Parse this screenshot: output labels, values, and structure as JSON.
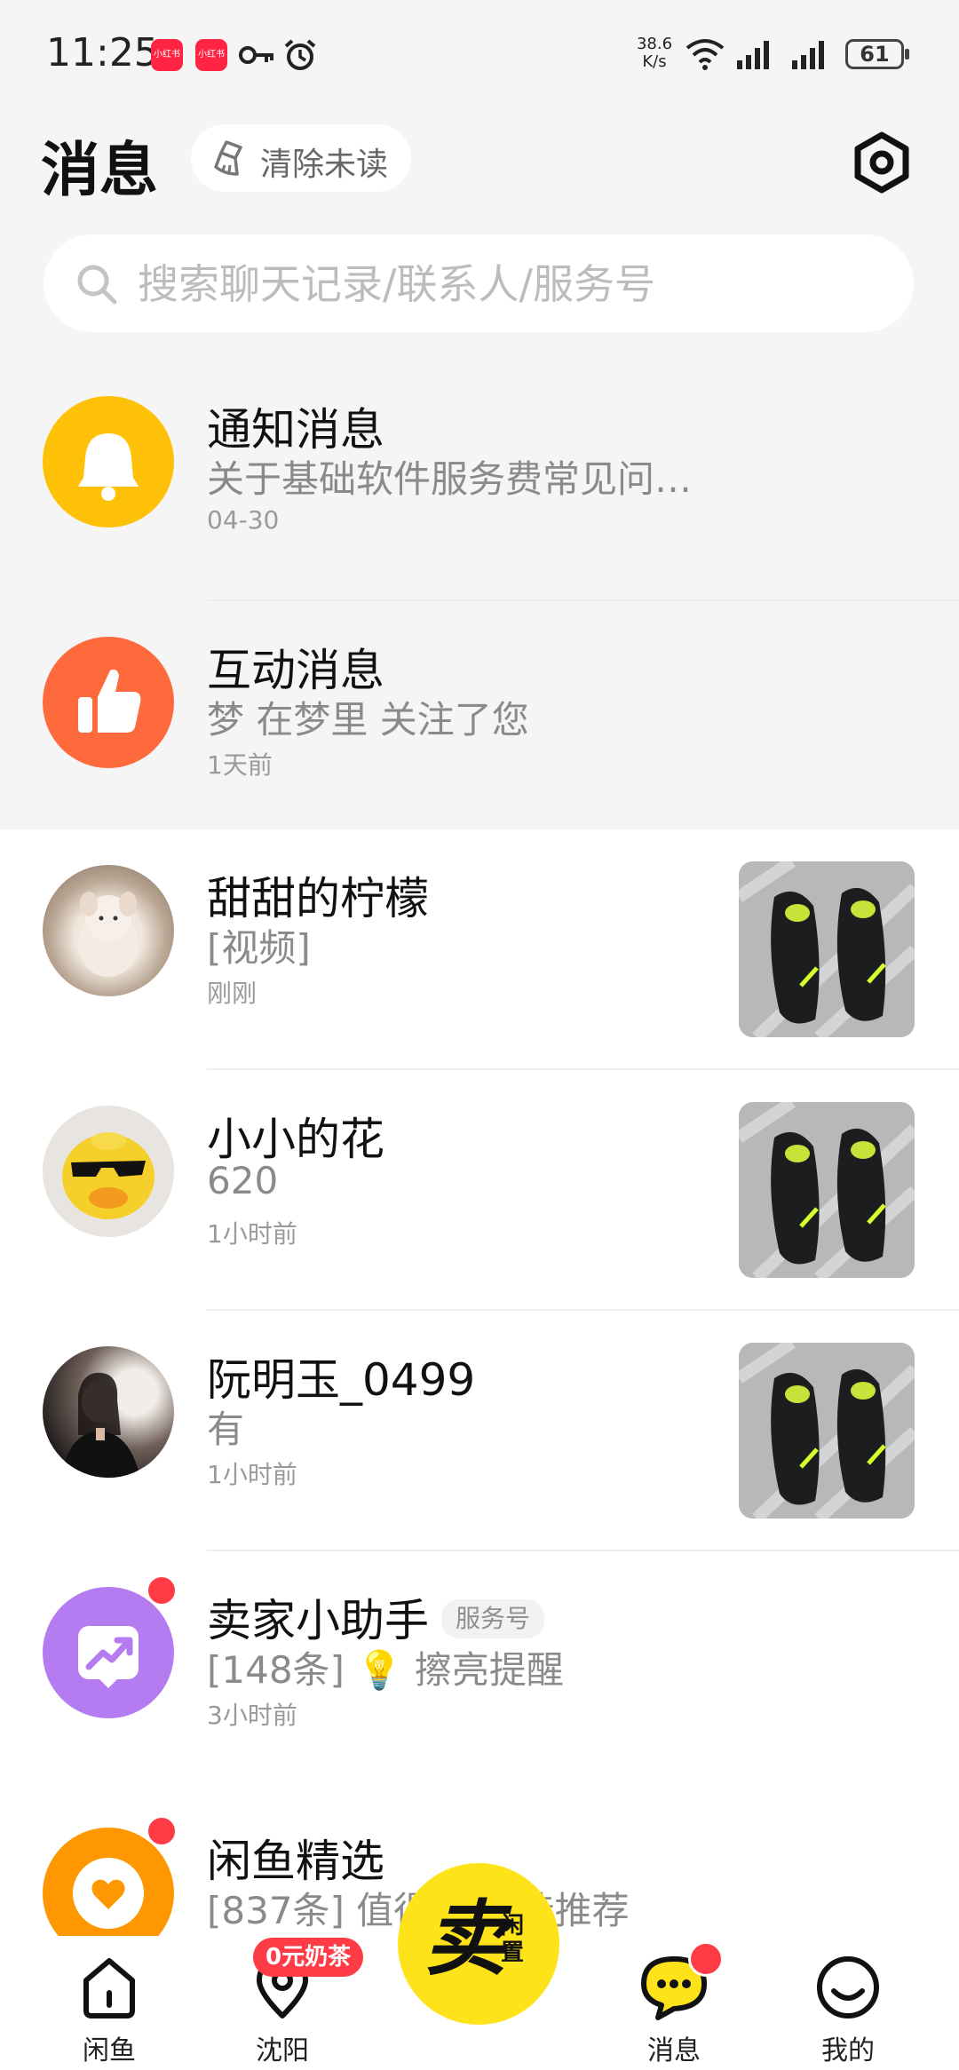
{
  "status_bar": {
    "time": "11:25",
    "app_icon_text": "小红书",
    "speed_value": "38.6",
    "speed_unit": "K/s",
    "battery": "61"
  },
  "header": {
    "title": "消息",
    "clear_unread_label": "清除未读"
  },
  "search": {
    "placeholder": "搜索聊天记录/联系人/服务号"
  },
  "conversations": [
    {
      "name": "通知消息",
      "preview": "关于基础软件服务费常见问…",
      "time": "04-30",
      "avatar_icon": "bell-icon",
      "color": "#ffc107"
    },
    {
      "name": "互动消息",
      "preview": "梦  在梦里 关注了您",
      "time": "1天前",
      "avatar_icon": "thumbs-up-icon",
      "color": "#ff6a3d"
    },
    {
      "name": "甜甜的柠檬",
      "preview": "[视频]",
      "time": "刚刚",
      "avatar_icon": "plush-toy-avatar"
    },
    {
      "name": "小小的花",
      "preview": "620",
      "time": "1小时前",
      "avatar_icon": "duck-avatar"
    },
    {
      "name": "阮明玉_0499",
      "preview": "有",
      "time": "1小时前",
      "avatar_icon": "person-avatar"
    },
    {
      "name": "卖家小助手",
      "tag": "服务号",
      "preview": "[148条] 💡 擦亮提醒",
      "time": "3小时前",
      "avatar_icon": "trend-chart-icon",
      "color": "#b57bf0"
    },
    {
      "name": "闲鱼精选",
      "preview": "[837条] 值得买·精选推荐",
      "time": "",
      "avatar_icon": "heart-icon",
      "color": "#ff9800"
    }
  ],
  "bottom_nav": {
    "items": [
      {
        "label": "闲鱼",
        "icon": "home-icon"
      },
      {
        "label": "沈阳",
        "icon": "location-pin-icon"
      },
      {
        "label": "消息",
        "icon": "chat-bubble-icon"
      },
      {
        "label": "我的",
        "icon": "smiley-face-icon"
      }
    ],
    "sell_big": "卖",
    "sell_small": "闲置",
    "promo": "0元奶茶"
  }
}
